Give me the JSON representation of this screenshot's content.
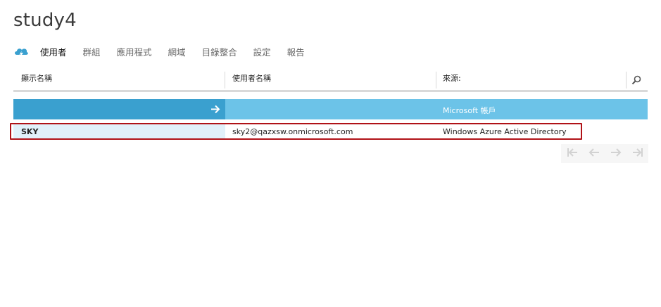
{
  "page": {
    "title": "study4"
  },
  "nav": {
    "items": [
      {
        "label": "使用者",
        "active": true
      },
      {
        "label": "群組"
      },
      {
        "label": "應用程式"
      },
      {
        "label": "網域"
      },
      {
        "label": "目錄整合"
      },
      {
        "label": "設定"
      },
      {
        "label": "報告"
      }
    ]
  },
  "table": {
    "columns": [
      {
        "label": "顯示名稱"
      },
      {
        "label": "使用者名稱"
      },
      {
        "label": "來源:"
      }
    ],
    "selected_row": {
      "source": "Microsoft 帳戶"
    },
    "rows": [
      {
        "display_name": "SKY",
        "user_name": "sky2@qazxsw.onmicrosoft.com",
        "source": "Windows Azure Active Directory"
      }
    ]
  },
  "colors": {
    "accent_dark": "#3aa0cf",
    "accent_light": "#6cc3e8",
    "row_highlight": "#e1f1fa",
    "annotation_border": "#b01217"
  },
  "icons": {
    "logo": "azure-cloud-icon",
    "search": "search-icon",
    "arrow": "arrow-right-icon",
    "pager": [
      "first-page-icon",
      "prev-page-icon",
      "next-page-icon",
      "last-page-icon"
    ]
  }
}
